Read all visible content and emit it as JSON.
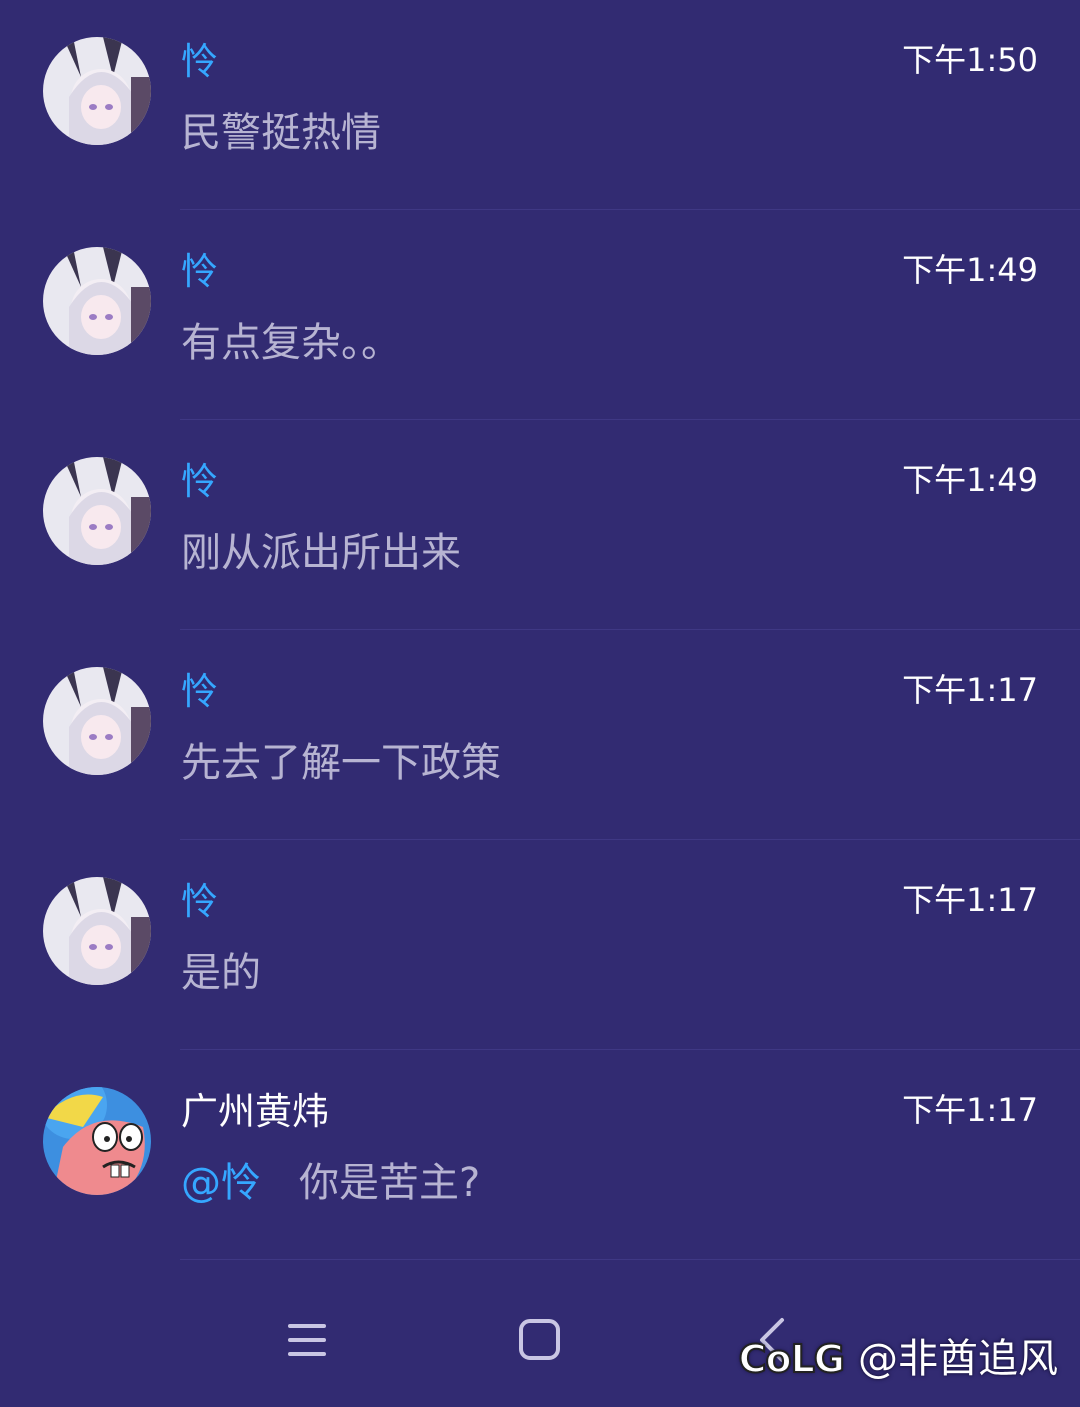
{
  "messages": [
    {
      "sender": "怜",
      "time": "下午1:50",
      "text": "民警挺热情",
      "avatar": "anime-girl-avatar",
      "mention": ""
    },
    {
      "sender": "怜",
      "time": "下午1:49",
      "text": "有点复杂。。",
      "avatar": "anime-girl-avatar",
      "mention": ""
    },
    {
      "sender": "怜",
      "time": "下午1:49",
      "text": "刚从派出所出来",
      "avatar": "anime-girl-avatar",
      "mention": ""
    },
    {
      "sender": "怜",
      "time": "下午1:17",
      "text": "先去了解一下政策",
      "avatar": "anime-girl-avatar",
      "mention": ""
    },
    {
      "sender": "怜",
      "time": "下午1:17",
      "text": "是的",
      "avatar": "anime-girl-avatar",
      "mention": ""
    },
    {
      "sender": "广州黄炜",
      "time": "下午1:17",
      "text": "你是苦主?",
      "avatar": "patrick-star-avatar",
      "mention": "@怜"
    }
  ],
  "navbar": {
    "menu_icon": "menu-icon",
    "home_icon": "home-icon",
    "back_icon": "back-icon"
  },
  "watermark": {
    "logo": "CoLG",
    "handle": "@非酋追风"
  },
  "colors": {
    "background": "#322b72",
    "accent": "#35a7ff",
    "message_text": "#b7b4d2"
  }
}
